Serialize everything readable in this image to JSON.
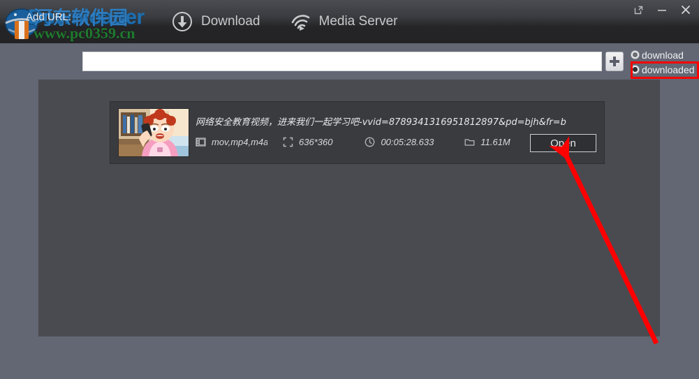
{
  "window": {
    "controls": [
      {
        "name": "restore-icon",
        "label": "Restore"
      },
      {
        "name": "minimize-icon",
        "label": "Minimize"
      },
      {
        "name": "close-icon",
        "label": "Close"
      }
    ]
  },
  "brand": {
    "product_name": "Downloader",
    "watermark_cn": "河东软件园",
    "watermark_url": "www.pc0359.cn",
    "logo_icon": "globe-icon"
  },
  "nav": {
    "items": [
      {
        "label": "Download",
        "icon": "download-circle-icon",
        "active": true
      },
      {
        "label": "Media Server",
        "icon": "wifi-cast-icon",
        "active": false
      }
    ]
  },
  "urlbar": {
    "label": "Add URL:",
    "input_value": "",
    "input_placeholder": "",
    "add_button_icon": "plus-icon"
  },
  "filters": {
    "options": [
      {
        "label": "download",
        "selected": false
      },
      {
        "label": "downloaded",
        "selected": true
      }
    ],
    "highlight_color": "#ff0000"
  },
  "list": {
    "items": [
      {
        "title": "网络安全教育视频，进来我们一起学习吧-vvid=8789341316951812897&pd=bjh&fr=b",
        "thumbnail_alt": "cartoon-woman-on-phone",
        "format": "mov,mp4,m4a",
        "format_icon": "film-icon",
        "resolution": "636*360",
        "resolution_icon": "resize-icon",
        "duration": "00:05:28.633",
        "duration_icon": "clock-icon",
        "size": "11.61M",
        "size_icon": "folder-icon",
        "action_label": "Open"
      }
    ]
  },
  "annotation": {
    "arrow_color": "#ff0000",
    "arrow_from": "940,492",
    "arrow_to": "805,214"
  },
  "theme": {
    "chrome_dark": "#232325",
    "body_slate": "#626773",
    "panel_dark": "#4a4b50",
    "card_dark": "#3a3b3f",
    "accent_blue": "#1f6fb0"
  }
}
